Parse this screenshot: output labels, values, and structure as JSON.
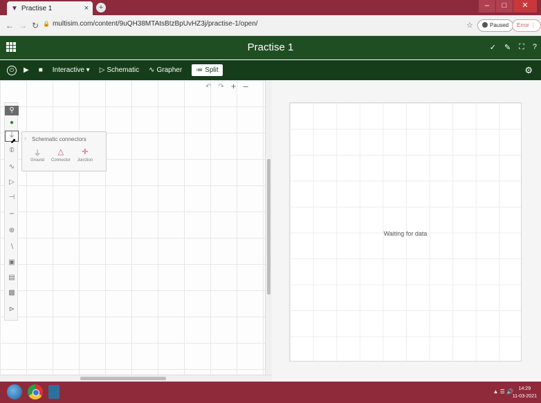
{
  "browser": {
    "tab_title": "Practise 1",
    "tab_close": "×",
    "new_tab": "+",
    "url": "multisim.com/content/9uQH38MTAtsBtzBpUvHZ3j/practise-1/open/",
    "profile_status": "Paused",
    "error_label": "Error"
  },
  "app": {
    "title": "Practise 1"
  },
  "toolbar": {
    "mode_label": "Interactive ▾",
    "schematic_label": "Schematic",
    "grapher_label": "Grapher",
    "split_label": "Split"
  },
  "palette": {
    "flyout_title": "Schematic connectors",
    "items": [
      {
        "label": "Ground"
      },
      {
        "label": "Connector"
      },
      {
        "label": "Junction"
      }
    ]
  },
  "grapher": {
    "status_text": "Waiting for data"
  },
  "taskbar": {
    "time": "14:29",
    "date": "11-03-2021"
  },
  "colors": {
    "header_bg": "#1f4e22",
    "toolbar_bg": "#163d19",
    "titlebar_bg": "#8d2a3c"
  }
}
